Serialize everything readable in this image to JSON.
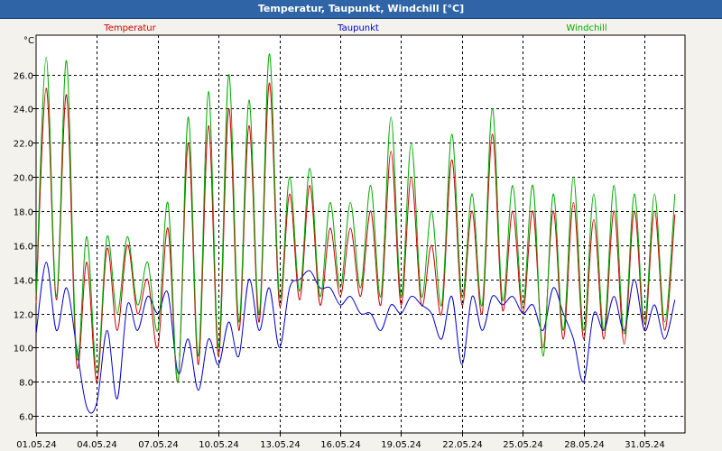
{
  "window": {
    "title": "Temperatur, Taupunkt, Windchill [°C]"
  },
  "chart_data": {
    "type": "line",
    "title": "Temperatur, Taupunkt, Windchill [°C]",
    "ylabel": "°C",
    "ylim": [
      5.0,
      28.3
    ],
    "yticks": [
      6.0,
      8.0,
      10.0,
      12.0,
      14.0,
      16.0,
      18.0,
      20.0,
      22.0,
      24.0,
      26.0
    ],
    "xlim": [
      "2024-05-01",
      "2024-06-02"
    ],
    "xticks": [
      "01.05.24",
      "04.05.24",
      "07.05.24",
      "10.05.24",
      "13.05.24",
      "16.05.24",
      "19.05.24",
      "22.05.24",
      "25.05.24",
      "28.05.24",
      "31.05.24"
    ],
    "grid": true,
    "legend": "top",
    "x": [
      0,
      0.5,
      1,
      1.5,
      2,
      2.5,
      3,
      3.5,
      4,
      4.5,
      5,
      5.5,
      6,
      6.5,
      7,
      7.5,
      8,
      8.5,
      9,
      9.5,
      10,
      10.5,
      11,
      11.5,
      12,
      12.5,
      13,
      13.5,
      14,
      14.5,
      15,
      15.5,
      16,
      16.5,
      17,
      17.5,
      18,
      18.5,
      19,
      19.5,
      20,
      20.5,
      21,
      21.5,
      22,
      22.5,
      23,
      23.5,
      24,
      24.5,
      25,
      25.5,
      26,
      26.5,
      27,
      27.5,
      28,
      28.5,
      29,
      29.5,
      30,
      30.5,
      31,
      31.5
    ],
    "series": [
      {
        "name": "Temperatur",
        "color": "#cc0000",
        "values": [
          12.6,
          25.2,
          12.8,
          24.8,
          9.0,
          15.0,
          8.0,
          15.8,
          11.0,
          16.0,
          12.0,
          14.0,
          10.0,
          17.0,
          8.0,
          22.0,
          9.0,
          23.0,
          9.5,
          24.0,
          11.0,
          23.0,
          11.5,
          25.5,
          12.5,
          19.0,
          12.8,
          19.5,
          12.5,
          17.0,
          13.0,
          17.0,
          13.0,
          18.0,
          12.5,
          21.5,
          12.5,
          20.0,
          12.5,
          16.0,
          12.0,
          21.0,
          12.5,
          18.0,
          12.0,
          22.5,
          12.2,
          18.0,
          12.0,
          18.0,
          10.0,
          18.0,
          10.5,
          18.5,
          10.5,
          17.5,
          10.5,
          18.0,
          10.2,
          18.0,
          11.0,
          18.0,
          11.0,
          17.8
        ]
      },
      {
        "name": "Taupunkt",
        "color": "#0000cc",
        "values": [
          10.8,
          15.0,
          11.0,
          13.5,
          10.0,
          6.5,
          6.8,
          11.0,
          7.0,
          12.5,
          11.0,
          13.0,
          12.0,
          13.2,
          8.5,
          10.5,
          7.5,
          10.5,
          9.0,
          11.5,
          9.5,
          14.0,
          11.0,
          13.5,
          10.0,
          13.5,
          14.0,
          14.5,
          13.5,
          13.5,
          12.5,
          13.0,
          12.0,
          12.0,
          11.0,
          12.5,
          12.0,
          13.0,
          12.5,
          12.0,
          10.5,
          13.0,
          9.0,
          13.0,
          11.0,
          13.0,
          12.5,
          13.0,
          12.0,
          12.5,
          11.0,
          13.5,
          12.0,
          10.5,
          8.0,
          12.0,
          11.0,
          13.0,
          11.0,
          14.0,
          11.0,
          12.5,
          10.5,
          12.8
        ]
      },
      {
        "name": "Windchill",
        "color": "#00aa00",
        "values": [
          13.0,
          27.0,
          13.0,
          26.8,
          9.5,
          16.5,
          8.5,
          16.5,
          12.0,
          16.5,
          12.5,
          15.0,
          11.0,
          18.5,
          8.0,
          23.5,
          9.5,
          25.0,
          10.0,
          26.0,
          11.5,
          24.5,
          12.0,
          27.2,
          13.0,
          20.0,
          13.3,
          20.5,
          13.0,
          18.5,
          13.5,
          18.5,
          13.5,
          19.5,
          13.0,
          23.5,
          13.0,
          22.0,
          13.0,
          18.0,
          12.5,
          22.5,
          13.0,
          19.0,
          12.5,
          24.0,
          12.8,
          19.5,
          12.5,
          19.5,
          9.5,
          19.0,
          11.0,
          20.0,
          11.0,
          19.0,
          11.0,
          19.5,
          10.8,
          19.0,
          11.5,
          19.0,
          11.5,
          19.0
        ]
      }
    ]
  }
}
